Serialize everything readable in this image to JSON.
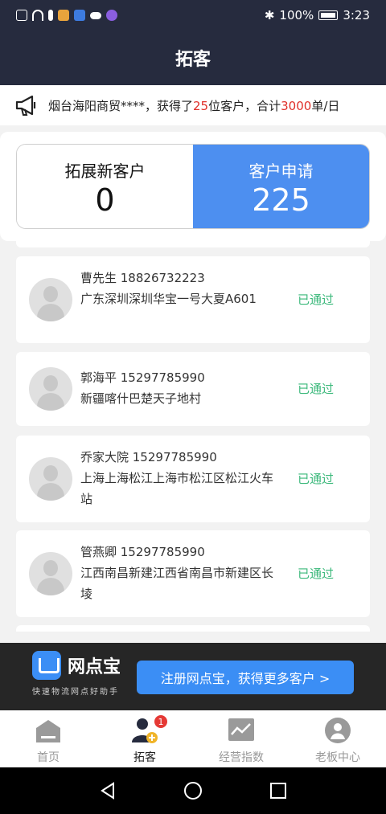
{
  "status_bar": {
    "battery": "100%",
    "time": "3:23"
  },
  "page_title": "拓客",
  "notice": {
    "prefix": "烟台海阳商贸****，获得了",
    "count": "25",
    "middle": "位客户，合计",
    "total": "3000",
    "suffix": "单/日"
  },
  "summary": {
    "new_label": "拓展新客户",
    "new_value": "0",
    "apply_label": "客户申请",
    "apply_value": "225"
  },
  "customers": [
    {
      "name_phone": "曹先生 18826732223",
      "address": "广东深圳深圳华宝一号大夏A601",
      "status": "已通过"
    },
    {
      "name_phone": "郭海平 15297785990",
      "address": "新疆喀什巴楚天子地村",
      "status": "已通过"
    },
    {
      "name_phone": "乔家大院 15297785990",
      "address": "上海上海松江上海市松江区松江火车站",
      "status": "已通过"
    },
    {
      "name_phone": "管燕卿 15297785990",
      "address": "江西南昌新建江西省南昌市新建区长堎",
      "status": "已通过"
    }
  ],
  "promo": {
    "app_name": "网点宝",
    "slogan": "快速物流网点好助手",
    "button": "注册网点宝，获得更多客户 >"
  },
  "tabbar": [
    {
      "label": "首页"
    },
    {
      "label": "拓客",
      "badge": "1"
    },
    {
      "label": "经营指数"
    },
    {
      "label": "老板中心"
    }
  ],
  "colors": {
    "header_bg": "#262b3e",
    "accent_blue": "#4d8ff0",
    "status_green": "#3ab87a",
    "highlight_red": "#e0302a"
  }
}
